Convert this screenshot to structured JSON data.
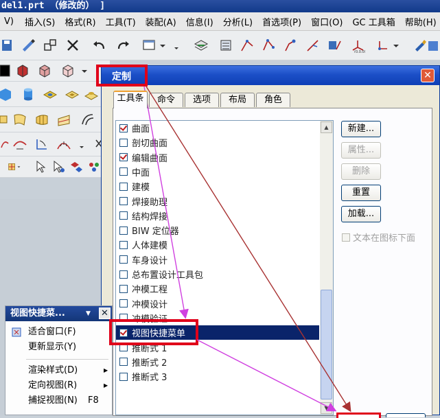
{
  "window": {
    "title": "del1.prt （修改的）  ]"
  },
  "menubar": [
    "V)",
    "插入(S)",
    "格式(R)",
    "工具(T)",
    "装配(A)",
    "信息(I)",
    "分析(L)",
    "首选项(P)",
    "窗口(O)",
    "GC 工具箱",
    "帮助(H)"
  ],
  "dialog": {
    "title": "定制",
    "tabs": [
      "工具条",
      "命令",
      "选项",
      "布局",
      "角色"
    ],
    "active_tab": "工具条",
    "toolbars": [
      {
        "label": "曲面",
        "checked": true
      },
      {
        "label": "剖切曲面",
        "checked": false
      },
      {
        "label": "编辑曲面",
        "checked": true
      },
      {
        "label": "中面",
        "checked": false
      },
      {
        "label": "建模",
        "checked": false
      },
      {
        "label": "焊接助理",
        "checked": false
      },
      {
        "label": "结构焊接",
        "checked": false
      },
      {
        "label": "BIW 定位器",
        "checked": false
      },
      {
        "label": "人体建模",
        "checked": false
      },
      {
        "label": "车身设计",
        "checked": false
      },
      {
        "label": "总布置设计工具包",
        "checked": false
      },
      {
        "label": "冲模工程",
        "checked": false
      },
      {
        "label": "冲模设计",
        "checked": false
      },
      {
        "label": "冲模验证",
        "checked": false
      },
      {
        "label": "视图快捷菜单",
        "checked": true,
        "selected": true
      },
      {
        "label": "推断式 1",
        "checked": false
      },
      {
        "label": "推断式 2",
        "checked": false
      },
      {
        "label": "推断式 3",
        "checked": false
      }
    ],
    "buttons": {
      "new": "新建...",
      "properties": "属性...",
      "delete": "删除",
      "reset": "重置",
      "load": "加载..."
    },
    "text_below_icon": "文本在图标下面"
  },
  "quick_menu": {
    "title": "视图快捷菜...",
    "items": [
      {
        "label": "适合窗口(F)",
        "shortcut": "",
        "submenu": false
      },
      {
        "label": "更新显示(Y)",
        "shortcut": "",
        "submenu": false
      },
      {
        "label": "渲染样式(D)",
        "shortcut": "",
        "submenu": true
      },
      {
        "label": "定向视图(R)",
        "shortcut": "",
        "submenu": true
      },
      {
        "label": "捕捉视图(N)",
        "shortcut": "F8",
        "submenu": false
      }
    ]
  },
  "colors": {
    "annotation": "#e0001a",
    "arrow_brown": "#a83232",
    "arrow_magenta": "#d040e0",
    "selection": "#0a246a"
  }
}
